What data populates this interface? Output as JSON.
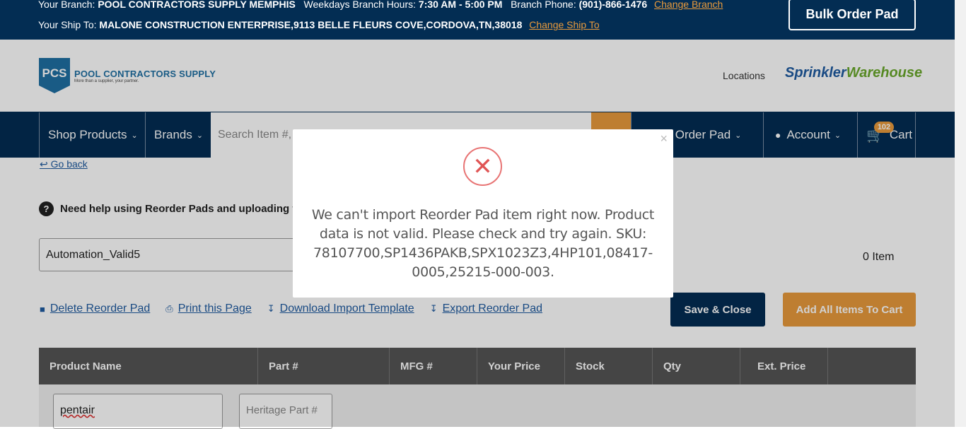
{
  "topbar": {
    "branch_label": "Your Branch: ",
    "branch_name": "POOL CONTRACTORS SUPPLY MEMPHIS",
    "hours_label": "Weekdays Branch Hours: ",
    "hours": "7:30 AM - 5:00 PM",
    "phone_label": "Branch Phone: ",
    "phone": "(901)-866-1476",
    "change_branch": "Change Branch",
    "shipto_label": "Your Ship To: ",
    "shipto": "MALONE CONSTRUCTION ENTERPRISE,9113 BELLE FLEURS COVE,CORDOVA,TN,38018",
    "change_shipto": "Change Ship To",
    "bulk_button": "Bulk Order Pad"
  },
  "header": {
    "logo_mark": "PCS",
    "logo_name": "POOL CONTRACTORS SUPPLY",
    "logo_tagline": "More than a supplier, your partner.",
    "locations": "Locations",
    "sprinkler_part1": "Sprinkler",
    "sprinkler_part2": "Warehouse"
  },
  "nav": {
    "shop_products": "Shop Products",
    "brands": "Brands",
    "search_placeholder": "Search Item #,",
    "quick_order": "ck Order Pad",
    "account": "Account",
    "cart": "Cart",
    "cart_count": "102"
  },
  "page": {
    "go_back": "Go back",
    "help_text": "Need help using Reorder Pads and uploading f",
    "pad_name": "Automation_Valid5",
    "item_count": "0 Item",
    "links": {
      "delete": "Delete Reorder Pad",
      "print": "Print this Page",
      "download": "Download Import Template",
      "export": "Export Reorder Pad"
    },
    "save_close": "Save & Close",
    "add_all": "Add All Items To Cart",
    "table": {
      "headers": [
        "Product Name",
        "Part #",
        "MFG #",
        "Your Price",
        "Stock",
        "Qty",
        "Ext. Price"
      ]
    },
    "product_value": "pentair",
    "part_placeholder": "Heritage Part #"
  },
  "modal": {
    "message": "We can't import Reorder Pad item right now. Product data is not valid. Please check and try again. SKU: 78107700,SP1436PAKB,SPX1023Z3,4HP101,08417-0005,25215-000-003.",
    "close": "×"
  }
}
